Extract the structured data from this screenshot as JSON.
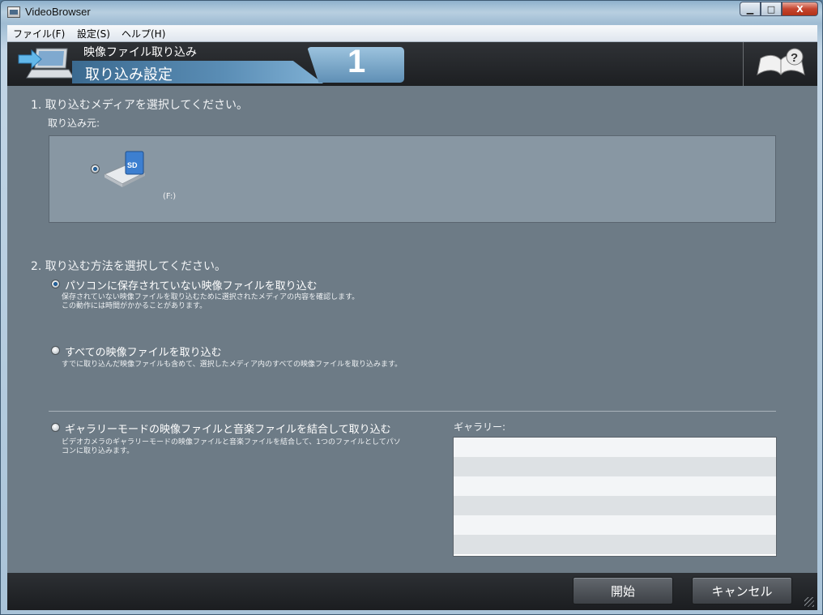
{
  "window": {
    "title": "VideoBrowser",
    "close_label": "X"
  },
  "menu": [
    {
      "label": "ファイル(F)"
    },
    {
      "label": "設定(S)"
    },
    {
      "label": "ヘルプ(H)"
    }
  ],
  "header": {
    "subtitle": "映像ファイル取り込み",
    "title": "取り込み設定",
    "step": "1"
  },
  "section1": {
    "title": "1. 取り込むメディアを選択してください。",
    "source_label": "取り込み元:",
    "media": [
      {
        "drive": "(F:)",
        "icon": "sd-card-reader-icon",
        "selected": true
      }
    ]
  },
  "section2": {
    "title": "2. 取り込む方法を選択してください。",
    "options": [
      {
        "label": "パソコンに保存されていない映像ファイルを取り込む",
        "desc1": "保存されていない映像ファイルを取り込むために選択されたメディアの内容を確認します。",
        "desc2": "この動作には時間がかかることがあります。",
        "selected": true
      },
      {
        "label": "すべての映像ファイルを取り込む",
        "desc1": "すでに取り込んだ映像ファイルも含めて、選択したメディア内のすべての映像ファイルを取り込みます。",
        "selected": false
      },
      {
        "label": "ギャラリーモードの映像ファイルと音楽ファイルを結合して取り込む",
        "desc1": "ビデオカメラのギャラリーモードの映像ファイルと音楽ファイルを結合して、1つのファイルとしてパソ",
        "desc2": "コンに取り込みます。",
        "selected": false
      }
    ],
    "gallery_label": "ギャラリー:"
  },
  "footer": {
    "start_label": "開始",
    "cancel_label": "キャンセル"
  },
  "colors": {
    "accent": "#5a8db5",
    "header_bg": "#1d1f22",
    "body_bg": "#6d7b86"
  }
}
